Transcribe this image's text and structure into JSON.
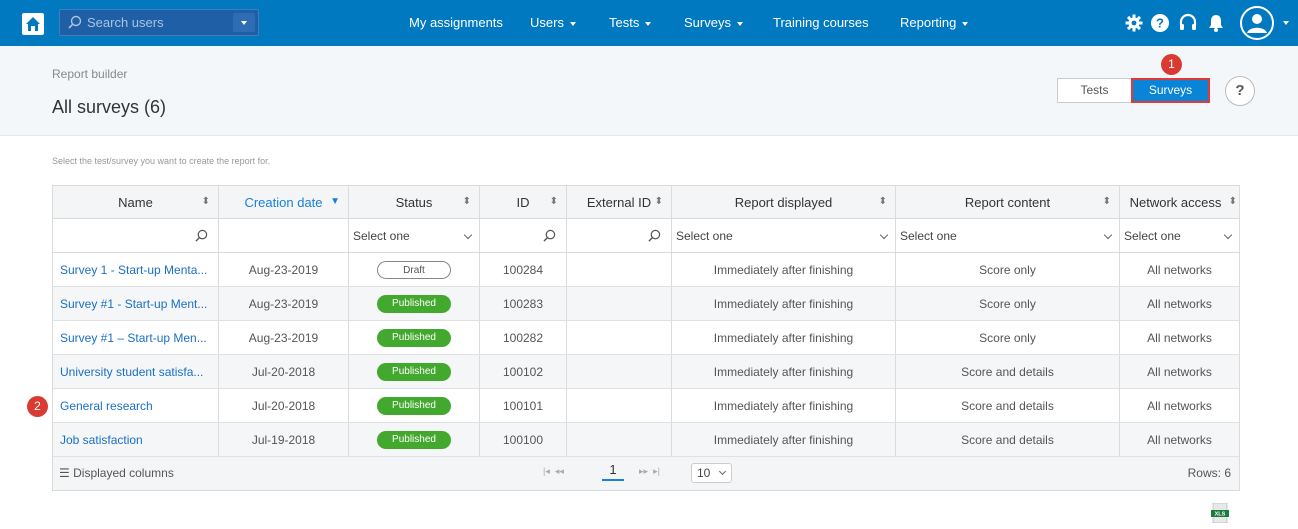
{
  "topbar": {
    "search_placeholder": "Search users",
    "nav": [
      {
        "label": "My assignments",
        "caret": false
      },
      {
        "label": "Users",
        "caret": true
      },
      {
        "label": "Tests",
        "caret": true
      },
      {
        "label": "Surveys",
        "caret": true
      },
      {
        "label": "Training courses",
        "caret": false
      },
      {
        "label": "Reporting",
        "caret": true
      }
    ],
    "icons": [
      "gear-icon",
      "help-icon",
      "headset-icon",
      "bell-icon",
      "user-avatar-icon"
    ],
    "color": "#0079c1"
  },
  "header": {
    "breadcrumb": "Report builder",
    "title": "All surveys (6)",
    "toggle_tests": "Tests",
    "toggle_surveys": "Surveys",
    "help": "?"
  },
  "badges": {
    "one": "1",
    "two": "2"
  },
  "instruction": "Select the test/survey you want to create the report for.",
  "table": {
    "columns": [
      "Name",
      "Creation date",
      "Status",
      "ID",
      "External ID",
      "Report displayed",
      "Report content",
      "Network access"
    ],
    "filters": {
      "select_placeholder": "Select one"
    },
    "rows": [
      {
        "name": "Survey 1 - Start-up Menta...",
        "date": "Aug-23-2019",
        "status": "Draft",
        "id": "100284",
        "external_id": "",
        "displayed": "Immediately after finishing",
        "content": "Score only",
        "network": "All networks"
      },
      {
        "name": "Survey #1 - Start-up Ment...",
        "date": "Aug-23-2019",
        "status": "Published",
        "id": "100283",
        "external_id": "",
        "displayed": "Immediately after finishing",
        "content": "Score only",
        "network": "All networks"
      },
      {
        "name": "Survey #1 – Start-up Men...",
        "date": "Aug-23-2019",
        "status": "Published",
        "id": "100282",
        "external_id": "",
        "displayed": "Immediately after finishing",
        "content": "Score only",
        "network": "All networks"
      },
      {
        "name": "University student satisfa...",
        "date": "Jul-20-2018",
        "status": "Published",
        "id": "100102",
        "external_id": "",
        "displayed": "Immediately after finishing",
        "content": "Score and details",
        "network": "All networks"
      },
      {
        "name": "General research",
        "date": "Jul-20-2018",
        "status": "Published",
        "id": "100101",
        "external_id": "",
        "displayed": "Immediately after finishing",
        "content": "Score and details",
        "network": "All networks"
      },
      {
        "name": "Job satisfaction",
        "date": "Jul-19-2018",
        "status": "Published",
        "id": "100100",
        "external_id": "",
        "displayed": "Immediately after finishing",
        "content": "Score and details",
        "network": "All networks"
      }
    ],
    "footer": {
      "displayed_columns": "Displayed columns",
      "current_page": "1",
      "page_size": "10",
      "rows_count": "Rows: 6"
    }
  },
  "export": {
    "label": "XLS"
  }
}
